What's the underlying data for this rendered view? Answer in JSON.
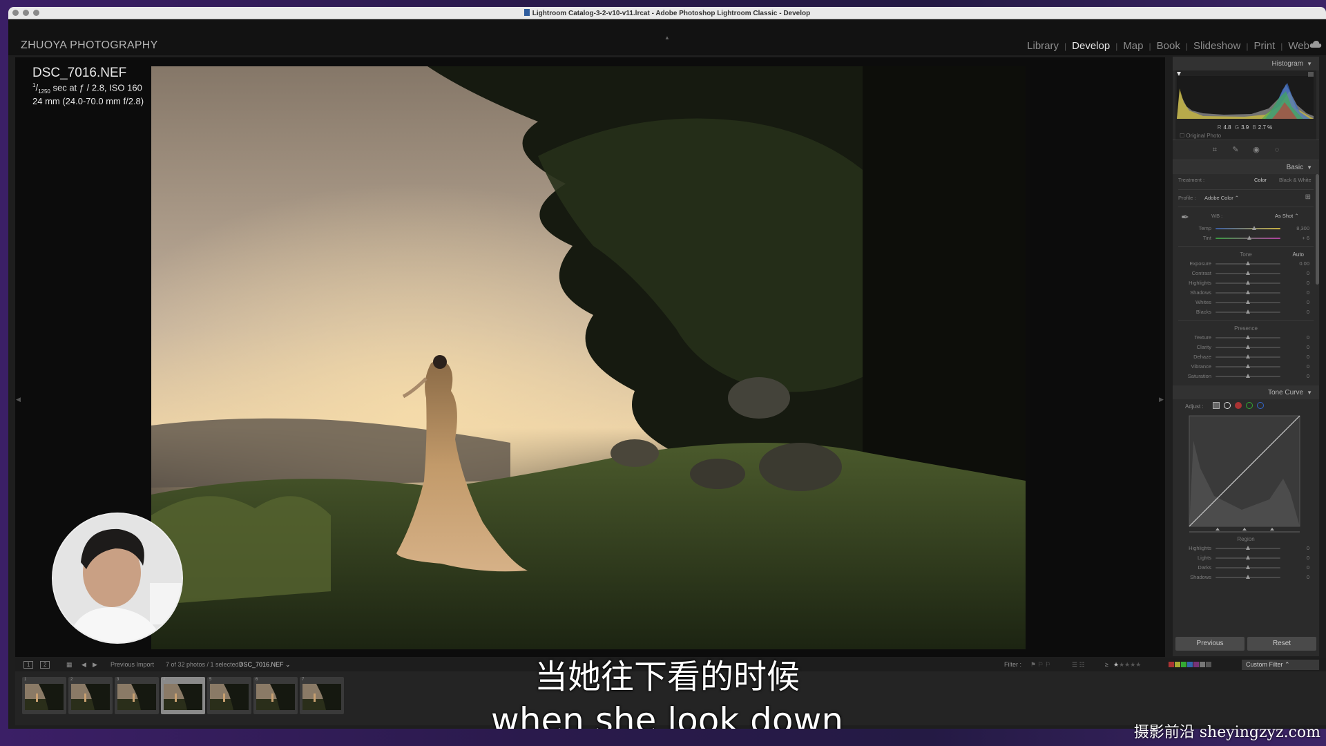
{
  "window": {
    "title": "Lightroom Catalog-3-2-v10-v11.lrcat - Adobe Photoshop Lightroom Classic - Develop"
  },
  "identity_plate": "ZHUOYA PHOTOGRAPHY",
  "modules": [
    "Library",
    "Develop",
    "Map",
    "Book",
    "Slideshow",
    "Print",
    "Web"
  ],
  "active_module": "Develop",
  "photo_info": {
    "filename": "DSC_7016.NEF",
    "exposure_num": "1",
    "exposure_den": "1250",
    "exposure_rest": " sec at ƒ / 2.8, ISO 160",
    "lens": "24 mm (24.0-70.0 mm f/2.8)"
  },
  "histogram": {
    "title": "Histogram",
    "r_label": "R",
    "r_val": "4.8",
    "g_label": "G",
    "g_val": "3.9",
    "b_label": "B",
    "b_val": "2.7 %",
    "original_photo": "Original Photo"
  },
  "basic": {
    "title": "Basic",
    "treatment_label": "Treatment :",
    "treatment_color": "Color",
    "treatment_bw": "Black & White",
    "profile_label": "Profile :",
    "profile_value": "Adobe Color",
    "wb_label": "WB :",
    "wb_value": "As Shot",
    "temp": {
      "label": "Temp",
      "value": "8,300",
      "pos": 0.6
    },
    "tint": {
      "label": "Tint",
      "value": "+ 6",
      "pos": 0.52
    },
    "tone_label": "Tone",
    "auto_label": "Auto",
    "tone_sliders": [
      {
        "label": "Exposure",
        "value": "0.00",
        "pos": 0.5
      },
      {
        "label": "Contrast",
        "value": "0",
        "pos": 0.5
      },
      {
        "label": "Highlights",
        "value": "0",
        "pos": 0.5
      },
      {
        "label": "Shadows",
        "value": "0",
        "pos": 0.5
      },
      {
        "label": "Whites",
        "value": "0",
        "pos": 0.5
      },
      {
        "label": "Blacks",
        "value": "0",
        "pos": 0.5
      }
    ],
    "presence_label": "Presence",
    "presence_sliders": [
      {
        "label": "Texture",
        "value": "0",
        "pos": 0.5
      },
      {
        "label": "Clarity",
        "value": "0",
        "pos": 0.5
      },
      {
        "label": "Dehaze",
        "value": "0",
        "pos": 0.5
      },
      {
        "label": "Vibrance",
        "value": "0",
        "pos": 0.5
      },
      {
        "label": "Saturation",
        "value": "0",
        "pos": 0.5
      }
    ]
  },
  "tone_curve": {
    "title": "Tone Curve",
    "adjust_label": "Adjust :",
    "region_label": "Region",
    "region_sliders": [
      {
        "label": "Highlights",
        "value": "0",
        "pos": 0.5
      },
      {
        "label": "Lights",
        "value": "0",
        "pos": 0.5
      },
      {
        "label": "Darks",
        "value": "0",
        "pos": 0.5
      },
      {
        "label": "Shadows",
        "value": "0",
        "pos": 0.5
      }
    ]
  },
  "buttons": {
    "previous": "Previous",
    "reset": "Reset"
  },
  "filmstrip_bar": {
    "view1": "1",
    "view2": "2",
    "source": "Previous Import",
    "count": "7 of 32 photos / 1 selected /",
    "current_file": "DSC_7016.NEF",
    "filter_label": "Filter :",
    "rating_op": "≥",
    "custom_filter": "Custom Filter"
  },
  "thumbnails": [
    "1",
    "2",
    "3",
    "4",
    "5",
    "6",
    "7"
  ],
  "selected_thumbnail": "4",
  "subtitles": {
    "cn": "当她往下看的时候",
    "en": "when she look down"
  },
  "watermark": "摄影前沿 sheyingzyz.com"
}
